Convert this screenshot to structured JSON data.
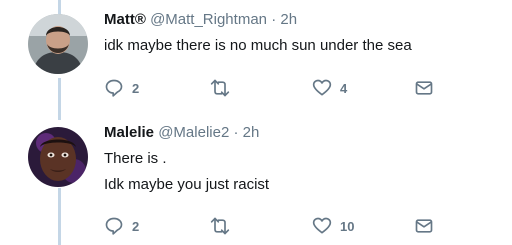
{
  "tweets": [
    {
      "name": "Matt®",
      "handle": "@Matt_Rightman",
      "separator": "·",
      "time": "2h",
      "text_lines": [
        "idk maybe there is no much sun under the sea"
      ],
      "actions": {
        "reply_count": "2",
        "retweet_count": "",
        "like_count": "4"
      }
    },
    {
      "name": "Malelie",
      "handle": "@Malelie2",
      "separator": "·",
      "time": "2h",
      "text_lines": [
        "There is .",
        "Idk maybe you just racist"
      ],
      "actions": {
        "reply_count": "2",
        "retweet_count": "",
        "like_count": "10"
      }
    }
  ],
  "icons": {
    "reply": "reply-icon",
    "retweet": "retweet-icon",
    "like": "heart-icon",
    "dm": "envelope-icon"
  },
  "colors": {
    "thread_line": "#c4d6e6",
    "name": "#14171a",
    "meta": "#657786",
    "background": "#ffffff"
  }
}
